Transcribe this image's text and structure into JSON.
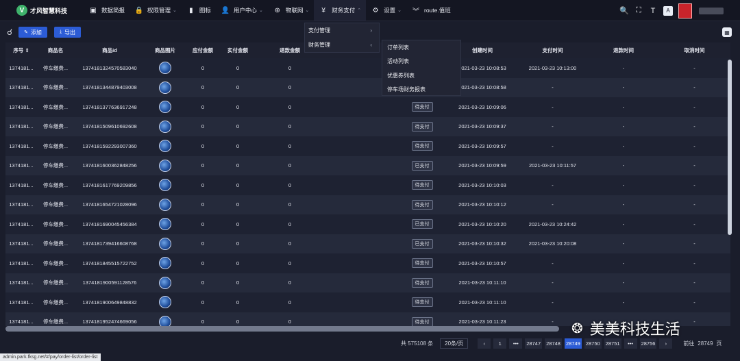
{
  "header": {
    "brand": "才风智慧科技",
    "logo_letter": "V",
    "nav": [
      {
        "label": "数据简报",
        "icon": "dashboard-icon",
        "glyph": "▣",
        "chevron": ""
      },
      {
        "label": "权限管理",
        "icon": "lock-icon",
        "glyph": "🔒",
        "chevron": "⌄"
      },
      {
        "label": "图标",
        "icon": "image-icon",
        "glyph": "▮",
        "chevron": ""
      },
      {
        "label": "用户中心",
        "icon": "user-icon",
        "glyph": "👤",
        "chevron": "⌄"
      },
      {
        "label": "物联网",
        "icon": "iot-icon",
        "glyph": "⊕",
        "chevron": "⌄"
      },
      {
        "label": "财务支付",
        "icon": "yen-icon",
        "glyph": "¥",
        "chevron": "⌃"
      },
      {
        "label": "设置",
        "icon": "settings-icon",
        "glyph": "⚙",
        "chevron": "⌄"
      },
      {
        "label": "route.值班",
        "icon": "duty-icon",
        "glyph": "︾",
        "chevron": ""
      }
    ],
    "tools": {
      "search": "🔍",
      "fullscreen": "⛶",
      "font_size": "T",
      "lang": "A"
    }
  },
  "toolbar": {
    "add_label": "添加",
    "add_glyph": "✎",
    "export_label": "导出",
    "export_glyph": "⤓"
  },
  "menus": {
    "level1": [
      {
        "label": "支付管理",
        "arrow": "›"
      },
      {
        "label": "财务管理",
        "arrow": "‹"
      }
    ],
    "level2": [
      "订单列表",
      "活动列表",
      "优惠券列表",
      "停车场财务报表"
    ]
  },
  "table": {
    "columns": [
      "序号 ⇕",
      "商品名",
      "商品id",
      "商品图片",
      "应付金额",
      "实付金额",
      "退款金额",
      "",
      "",
      "创建时间",
      "支付时间",
      "退款时间",
      "取消时间"
    ],
    "rows": [
      {
        "no": "1374181...",
        "name": "停车缴费...",
        "id": "1374181324570583040",
        "due": "0",
        "paid": "0",
        "refund": "0",
        "status": "",
        "created": "2021-03-23 10:08:53",
        "pay_time": "2021-03-23 10:13:00",
        "refund_time": "-",
        "cancel_time": "-"
      },
      {
        "no": "1374181...",
        "name": "停车缴费...",
        "id": "1374181344879403008",
        "due": "0",
        "paid": "0",
        "refund": "0",
        "status": "",
        "created": "2021-03-23 10:08:58",
        "pay_time": "-",
        "refund_time": "-",
        "cancel_time": "-"
      },
      {
        "no": "1374181...",
        "name": "停车缴费...",
        "id": "1374181377636917248",
        "due": "0",
        "paid": "0",
        "refund": "0",
        "status": "待支付",
        "created": "2021-03-23 10:09:06",
        "pay_time": "-",
        "refund_time": "-",
        "cancel_time": "-"
      },
      {
        "no": "1374181...",
        "name": "停车缴费...",
        "id": "1374181509610692608",
        "due": "0",
        "paid": "0",
        "refund": "0",
        "status": "待支付",
        "created": "2021-03-23 10:09:37",
        "pay_time": "-",
        "refund_time": "-",
        "cancel_time": "-"
      },
      {
        "no": "1374181...",
        "name": "停车缴费...",
        "id": "1374181592293007360",
        "due": "0",
        "paid": "0",
        "refund": "0",
        "status": "待支付",
        "created": "2021-03-23 10:09:57",
        "pay_time": "-",
        "refund_time": "-",
        "cancel_time": "-"
      },
      {
        "no": "1374181...",
        "name": "停车缴费...",
        "id": "1374181600362848256",
        "due": "0",
        "paid": "0",
        "refund": "0",
        "status": "已支付",
        "created": "2021-03-23 10:09:59",
        "pay_time": "2021-03-23 10:11:57",
        "refund_time": "-",
        "cancel_time": "-"
      },
      {
        "no": "1374181...",
        "name": "停车缴费...",
        "id": "1374181617769209856",
        "due": "0",
        "paid": "0",
        "refund": "0",
        "status": "待支付",
        "created": "2021-03-23 10:10:03",
        "pay_time": "-",
        "refund_time": "-",
        "cancel_time": "-"
      },
      {
        "no": "1374181...",
        "name": "停车缴费...",
        "id": "1374181654721028096",
        "due": "0",
        "paid": "0",
        "refund": "0",
        "status": "待支付",
        "created": "2021-03-23 10:10:12",
        "pay_time": "-",
        "refund_time": "-",
        "cancel_time": "-"
      },
      {
        "no": "1374181...",
        "name": "停车缴费...",
        "id": "1374181690045456384",
        "due": "0",
        "paid": "0",
        "refund": "0",
        "status": "已支付",
        "created": "2021-03-23 10:10:20",
        "pay_time": "2021-03-23 10:24:42",
        "refund_time": "-",
        "cancel_time": "-"
      },
      {
        "no": "1374181...",
        "name": "停车缴费...",
        "id": "1374181739416608768",
        "due": "0",
        "paid": "0",
        "refund": "0",
        "status": "已支付",
        "created": "2021-03-23 10:10:32",
        "pay_time": "2021-03-23 10:20:08",
        "refund_time": "-",
        "cancel_time": "-"
      },
      {
        "no": "1374181...",
        "name": "停车缴费...",
        "id": "1374181845515722752",
        "due": "0",
        "paid": "0",
        "refund": "0",
        "status": "待支付",
        "created": "2021-03-23 10:10:57",
        "pay_time": "-",
        "refund_time": "-",
        "cancel_time": "-"
      },
      {
        "no": "1374181...",
        "name": "停车缴费...",
        "id": "1374181900591128576",
        "due": "0",
        "paid": "0",
        "refund": "0",
        "status": "待支付",
        "created": "2021-03-23 10:11:10",
        "pay_time": "-",
        "refund_time": "-",
        "cancel_time": "-"
      },
      {
        "no": "1374181...",
        "name": "停车缴费...",
        "id": "1374181900649848832",
        "due": "0",
        "paid": "0",
        "refund": "0",
        "status": "待支付",
        "created": "2021-03-23 10:11:10",
        "pay_time": "-",
        "refund_time": "-",
        "cancel_time": "-"
      },
      {
        "no": "1374181...",
        "name": "停车缴费...",
        "id": "1374181952474669056",
        "due": "0",
        "paid": "0",
        "refund": "0",
        "status": "待支付",
        "created": "2021-03-23 10:11:23",
        "pay_time": "-",
        "refund_time": "-",
        "cancel_time": "-"
      }
    ]
  },
  "pagination": {
    "total": "共 575108 条",
    "page_size": "20条/页",
    "pages": [
      "1",
      "•••",
      "28747",
      "28748",
      "28749",
      "28750",
      "28751",
      "•••",
      "28756"
    ],
    "current": "28749",
    "jump_prefix": "前往",
    "jump_value": "28749",
    "jump_suffix": "页"
  },
  "status_bar_url": "admin.park.fksg.net/#/pay/order-list/order-list",
  "watermark": "美美科技生活",
  "colors": {
    "accent": "#2c5cd6",
    "bg": "#1a1d2b",
    "topbar": "#141622"
  }
}
